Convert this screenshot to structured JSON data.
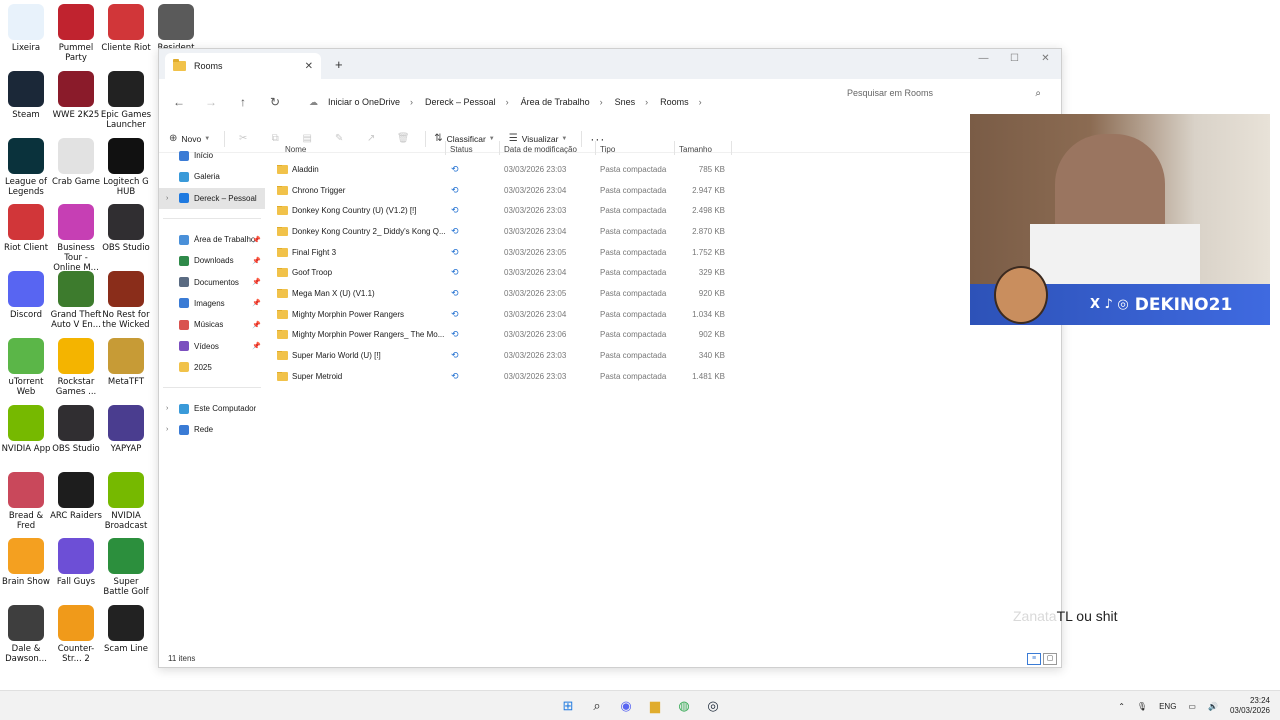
{
  "desktop": {
    "icons": [
      {
        "label": "Lixeira",
        "color": "#e8f2fb"
      },
      {
        "label": "Pummel Party",
        "color": "#c0232f"
      },
      {
        "label": "Cliente Riot",
        "color": "#d13639"
      },
      {
        "label": "Resident Evil",
        "color": "#5a5a5a"
      },
      {
        "label": "Steam",
        "color": "#1b2838"
      },
      {
        "label": "WWE 2K25",
        "color": "#8a1b2a"
      },
      {
        "label": "Epic Games Launcher",
        "color": "#222222"
      },
      {
        "label": "League of Legends",
        "color": "#0a323c"
      },
      {
        "label": "Crab Game",
        "color": "#e2e2e2"
      },
      {
        "label": "Logitech G HUB",
        "color": "#111111"
      },
      {
        "label": "Riot Client",
        "color": "#d13639"
      },
      {
        "label": "Business Tour - Online M...",
        "color": "#c63fb4"
      },
      {
        "label": "OBS Studio",
        "color": "#302e31"
      },
      {
        "label": "Discord",
        "color": "#5865f2"
      },
      {
        "label": "Grand Theft Auto V En...",
        "color": "#3d7b2d"
      },
      {
        "label": "No Rest for the Wicked",
        "color": "#8a2d1a"
      },
      {
        "label": "uTorrent Web",
        "color": "#5bb648"
      },
      {
        "label": "Rockstar Games ...",
        "color": "#f4b400"
      },
      {
        "label": "MetaTFT",
        "color": "#c79b36"
      },
      {
        "label": "NVIDIA App",
        "color": "#76b900"
      },
      {
        "label": "OBS Studio",
        "color": "#302e31"
      },
      {
        "label": "YAPYAP",
        "color": "#4a3d8f"
      },
      {
        "label": "Bread & Fred",
        "color": "#c9485b"
      },
      {
        "label": "ARC Raiders",
        "color": "#1d1d1d"
      },
      {
        "label": "NVIDIA Broadcast",
        "color": "#76b900"
      },
      {
        "label": "Brain Show",
        "color": "#f4a020"
      },
      {
        "label": "Fall Guys",
        "color": "#6d4fd6"
      },
      {
        "label": "Super Battle Golf",
        "color": "#2c8f3d"
      },
      {
        "label": "Dale & Dawson...",
        "color": "#3e3e3e"
      },
      {
        "label": "Counter-Str... 2",
        "color": "#f09a1a"
      },
      {
        "label": "Scam Line",
        "color": "#222222"
      }
    ]
  },
  "window": {
    "tab_title": "Rooms",
    "new_tab": "+",
    "breadcrumb": [
      "Iniciar o OneDrive",
      "Dereck – Pessoal",
      "Área de Trabalho",
      "Snes",
      "Rooms"
    ],
    "search_placeholder": "Pesquisar em Rooms",
    "toolbar": {
      "new_label": "Novo",
      "sort_label": "Classificar",
      "view_label": "Visualizar",
      "more_label": "···"
    },
    "sidebar": {
      "top": [
        {
          "label": "Início",
          "color": "#3a7bd5"
        },
        {
          "label": "Galeria",
          "color": "#3a9ad9"
        },
        {
          "label": "Dereck – Pessoal",
          "color": "#1f7ae0"
        }
      ],
      "pinned": [
        {
          "label": "Área de Trabalho",
          "color": "#4a90d9"
        },
        {
          "label": "Downloads",
          "color": "#2f8a4a"
        },
        {
          "label": "Documentos",
          "color": "#5a6b82"
        },
        {
          "label": "Imagens",
          "color": "#3a7bd5"
        },
        {
          "label": "Músicas",
          "color": "#d9534f"
        },
        {
          "label": "Vídeos",
          "color": "#7b4fbf"
        },
        {
          "label": "2025",
          "color": "#f1c24a"
        }
      ],
      "bottom": [
        {
          "label": "Este Computador",
          "color": "#3a9ad9"
        },
        {
          "label": "Rede",
          "color": "#3a7bd5"
        }
      ]
    },
    "columns": {
      "name": "Nome",
      "status": "Status",
      "date": "Data de modificação",
      "type": "Tipo",
      "size": "Tamanho"
    },
    "files": [
      {
        "name": "Aladdin",
        "date": "03/03/2026 23:03",
        "type": "Pasta compactada",
        "size": "785 KB"
      },
      {
        "name": "Chrono Trigger",
        "date": "03/03/2026 23:04",
        "type": "Pasta compactada",
        "size": "2.947 KB"
      },
      {
        "name": "Donkey Kong Country (U) (V1.2) [!]",
        "date": "03/03/2026 23:03",
        "type": "Pasta compactada",
        "size": "2.498 KB"
      },
      {
        "name": "Donkey Kong Country 2_ Diddy's Kong Q...",
        "date": "03/03/2026 23:04",
        "type": "Pasta compactada",
        "size": "2.870 KB"
      },
      {
        "name": "Final Fight 3",
        "date": "03/03/2026 23:05",
        "type": "Pasta compactada",
        "size": "1.752 KB"
      },
      {
        "name": "Goof Troop",
        "date": "03/03/2026 23:04",
        "type": "Pasta compactada",
        "size": "329 KB"
      },
      {
        "name": "Mega Man X (U) (V1.1)",
        "date": "03/03/2026 23:05",
        "type": "Pasta compactada",
        "size": "920 KB"
      },
      {
        "name": "Mighty Morphin Power Rangers",
        "date": "03/03/2026 23:04",
        "type": "Pasta compactada",
        "size": "1.034 KB"
      },
      {
        "name": "Mighty Morphin Power Rangers_ The Mo...",
        "date": "03/03/2026 23:06",
        "type": "Pasta compactada",
        "size": "902 KB"
      },
      {
        "name": "Super Mario World (U) [!]",
        "date": "03/03/2026 23:03",
        "type": "Pasta compactada",
        "size": "340 KB"
      },
      {
        "name": "Super Metroid",
        "date": "03/03/2026 23:03",
        "type": "Pasta compactada",
        "size": "1.481 KB"
      }
    ],
    "status_text": "11 itens"
  },
  "webcam": {
    "banner_text": "DEKINO21",
    "social_icons": "X ♪ ◎"
  },
  "overlay": {
    "part_a": "Zanata",
    "part_b": "TL ou shit"
  },
  "taskbar": {
    "language": "ENG",
    "time": "23:24",
    "date": "03/03/2026"
  }
}
